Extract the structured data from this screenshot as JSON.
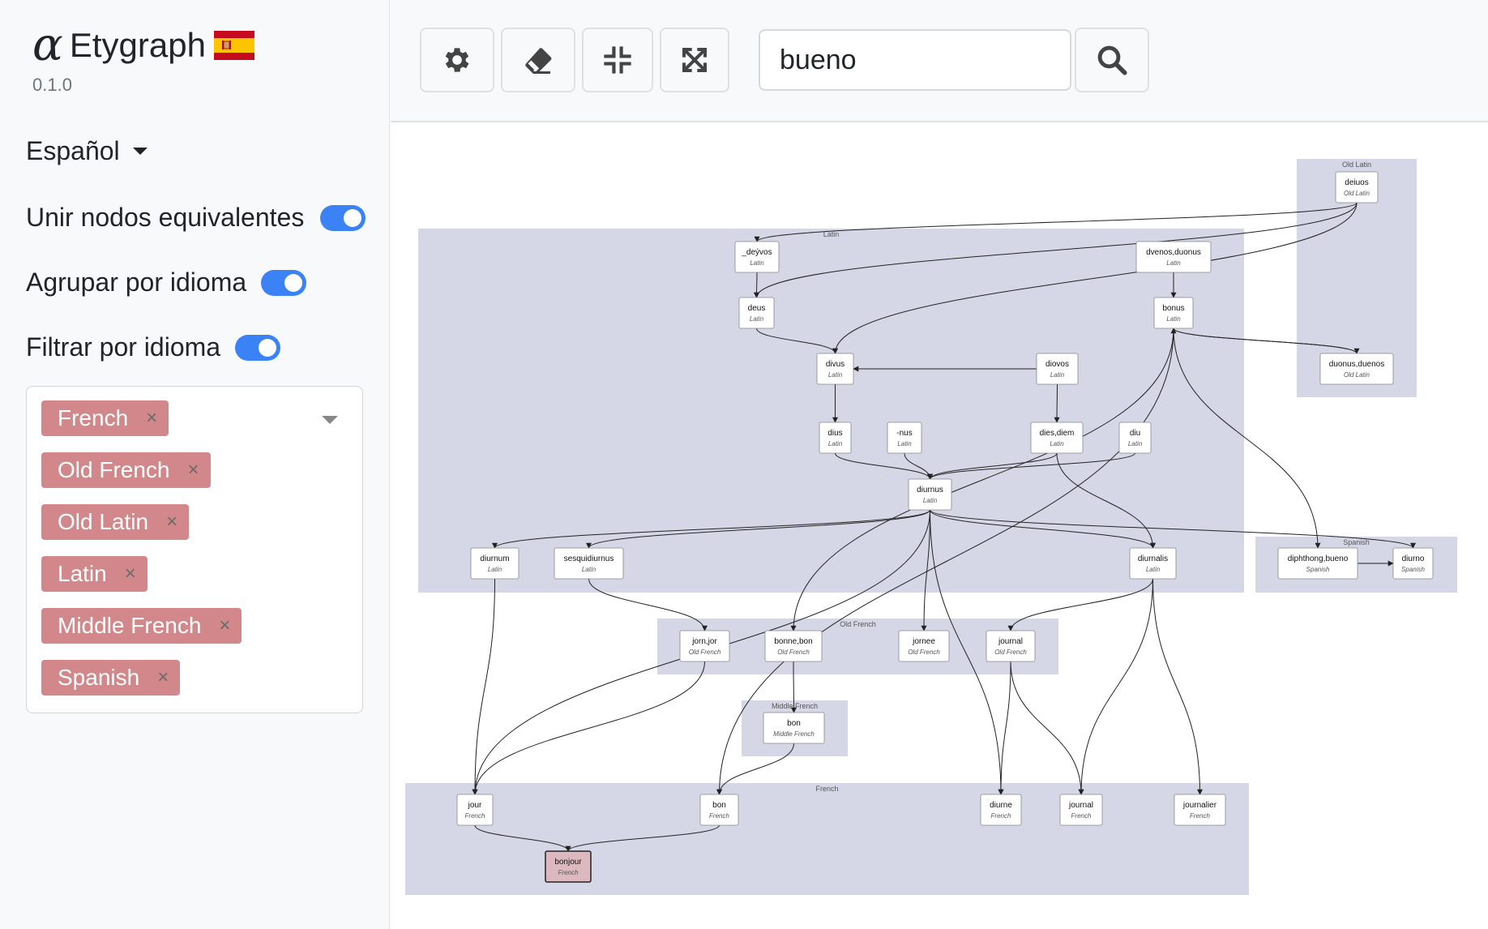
{
  "app": {
    "title": "Etygraph",
    "version": "0.1.0",
    "logo_glyph": "α",
    "flag_icon": "spain-flag-icon"
  },
  "sidebar": {
    "language": "Español",
    "options": [
      {
        "label": "Unir nodos equivalentes",
        "on": true
      },
      {
        "label": "Agrupar por idioma",
        "on": true
      },
      {
        "label": "Filtrar por idioma",
        "on": true
      }
    ],
    "filter_tags": [
      "French",
      "Old French",
      "Old Latin",
      "Latin",
      "Middle French",
      "Spanish"
    ],
    "tag_remove_glyph": "×"
  },
  "toolbar": {
    "buttons": [
      "gear-icon",
      "eraser-icon",
      "compress-icon",
      "expand-icon"
    ],
    "search_value": "bueno",
    "search_button_icon": "search-icon"
  },
  "colors": {
    "accent": "#3b82f6",
    "tag": "#d2878a",
    "cluster": "#d5d7e6",
    "highlight": "#dbb9bf"
  },
  "graph": {
    "clusters": [
      {
        "id": "latin",
        "label": "Latin"
      },
      {
        "id": "oldlatin",
        "label": "Old Latin"
      },
      {
        "id": "spanish",
        "label": "Spanish"
      },
      {
        "id": "oldfrench",
        "label": "Old French"
      },
      {
        "id": "middlefrench",
        "label": "Middle French"
      },
      {
        "id": "french",
        "label": "French"
      }
    ],
    "nodes": [
      {
        "id": "deiuos",
        "word": "deiuos",
        "lang": "Old Latin"
      },
      {
        "id": "duonus_duenos",
        "word": "duonus,duenos",
        "lang": "Old Latin"
      },
      {
        "id": "devos",
        "word": "_deývos",
        "lang": "Latin"
      },
      {
        "id": "dvenos_duonus",
        "word": "dvenos,duonus",
        "lang": "Latin"
      },
      {
        "id": "deus",
        "word": "deus",
        "lang": "Latin"
      },
      {
        "id": "bonus",
        "word": "bonus",
        "lang": "Latin"
      },
      {
        "id": "divus",
        "word": "divus",
        "lang": "Latin"
      },
      {
        "id": "diovos",
        "word": "diovos",
        "lang": "Latin"
      },
      {
        "id": "dius",
        "word": "dius",
        "lang": "Latin"
      },
      {
        "id": "nus",
        "word": "-nus",
        "lang": "Latin"
      },
      {
        "id": "dies_diem",
        "word": "dies,diem",
        "lang": "Latin"
      },
      {
        "id": "diu",
        "word": "diu",
        "lang": "Latin"
      },
      {
        "id": "diurnus",
        "word": "diurnus",
        "lang": "Latin"
      },
      {
        "id": "diurnum",
        "word": "diurnum",
        "lang": "Latin"
      },
      {
        "id": "sesquidiurnus",
        "word": "sesquidiurnus",
        "lang": "Latin"
      },
      {
        "id": "diurnalis",
        "word": "diurnalis",
        "lang": "Latin"
      },
      {
        "id": "diphthong_bueno",
        "word": "diphthong,bueno",
        "lang": "Spanish"
      },
      {
        "id": "diurno",
        "word": "diurno",
        "lang": "Spanish"
      },
      {
        "id": "jorn_jor",
        "word": "jorn,jor",
        "lang": "Old French"
      },
      {
        "id": "bonne_bon",
        "word": "bonne,bon",
        "lang": "Old French"
      },
      {
        "id": "jornee",
        "word": "jornee",
        "lang": "Old French"
      },
      {
        "id": "journal_of",
        "word": "journal",
        "lang": "Old French"
      },
      {
        "id": "bon_mf",
        "word": "bon",
        "lang": "Middle French"
      },
      {
        "id": "jour",
        "word": "jour",
        "lang": "French"
      },
      {
        "id": "bon_fr",
        "word": "bon",
        "lang": "French"
      },
      {
        "id": "diurne",
        "word": "diurne",
        "lang": "French"
      },
      {
        "id": "journal_fr",
        "word": "journal",
        "lang": "French"
      },
      {
        "id": "journalier",
        "word": "journalier",
        "lang": "French"
      },
      {
        "id": "bonjour",
        "word": "bonjour",
        "lang": "French",
        "highlight": true
      }
    ],
    "edges": [
      [
        "deiuos",
        "devos"
      ],
      [
        "deiuos",
        "deus"
      ],
      [
        "deiuos",
        "divus"
      ],
      [
        "duonus_duenos",
        "bonus"
      ],
      [
        "bonus",
        "duonus_duenos"
      ],
      [
        "devos",
        "deus"
      ],
      [
        "dvenos_duonus",
        "bonus"
      ],
      [
        "deus",
        "divus"
      ],
      [
        "diovos",
        "divus"
      ],
      [
        "divus",
        "dius"
      ],
      [
        "dius",
        "diurnus"
      ],
      [
        "nus",
        "diurnus"
      ],
      [
        "dies_diem",
        "diurnus"
      ],
      [
        "diu",
        "diurnus"
      ],
      [
        "diovos",
        "dies_diem"
      ],
      [
        "dies_diem",
        "diurnalis"
      ],
      [
        "diurnus",
        "diurnum"
      ],
      [
        "diurnus",
        "sesquidiurnus"
      ],
      [
        "diurnus",
        "diurnalis"
      ],
      [
        "diurnus",
        "diurno"
      ],
      [
        "diurnus",
        "jornee"
      ],
      [
        "diurnus",
        "jour"
      ],
      [
        "diurnus",
        "diurne"
      ],
      [
        "bonus",
        "diphthong_bueno"
      ],
      [
        "bonus",
        "bonne_bon"
      ],
      [
        "bonus",
        "bon_fr"
      ],
      [
        "diphthong_bueno",
        "diurno"
      ],
      [
        "diurnum",
        "jour"
      ],
      [
        "sesquidiurnus",
        "jorn_jor"
      ],
      [
        "jorn_jor",
        "jour"
      ],
      [
        "diurnalis",
        "journal_of"
      ],
      [
        "diurnalis",
        "journal_fr"
      ],
      [
        "diurnalis",
        "journalier"
      ],
      [
        "journal_of",
        "diurne"
      ],
      [
        "journal_of",
        "journal_fr"
      ],
      [
        "bonne_bon",
        "bon_mf"
      ],
      [
        "bon_mf",
        "bon_fr"
      ],
      [
        "jour",
        "bonjour"
      ],
      [
        "bon_fr",
        "bonjour"
      ]
    ]
  }
}
